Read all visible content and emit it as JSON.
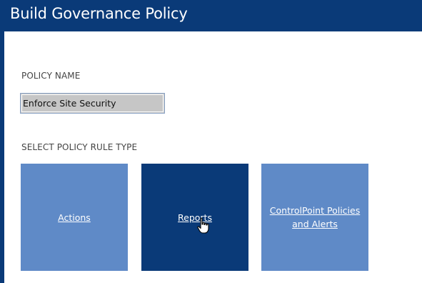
{
  "window": {
    "title": "Build Governance Policy"
  },
  "form": {
    "policy_name_label": "POLICY NAME",
    "policy_name_value": "Enforce Site Security",
    "rule_type_label": "SELECT POLICY RULE TYPE"
  },
  "tiles": [
    {
      "label": "Actions",
      "color": "#5f8ac7"
    },
    {
      "label": "Reports",
      "color": "#0a3a78",
      "state": "hovered"
    },
    {
      "label": "ControlPoint Policies and Alerts",
      "color": "#5f8ac7"
    }
  ],
  "colors": {
    "accent": "#0a3a78",
    "tile": "#5f8ac7",
    "input_bg": "#c6c6c6"
  },
  "cursor": {
    "icon": "hand-pointer-icon"
  }
}
